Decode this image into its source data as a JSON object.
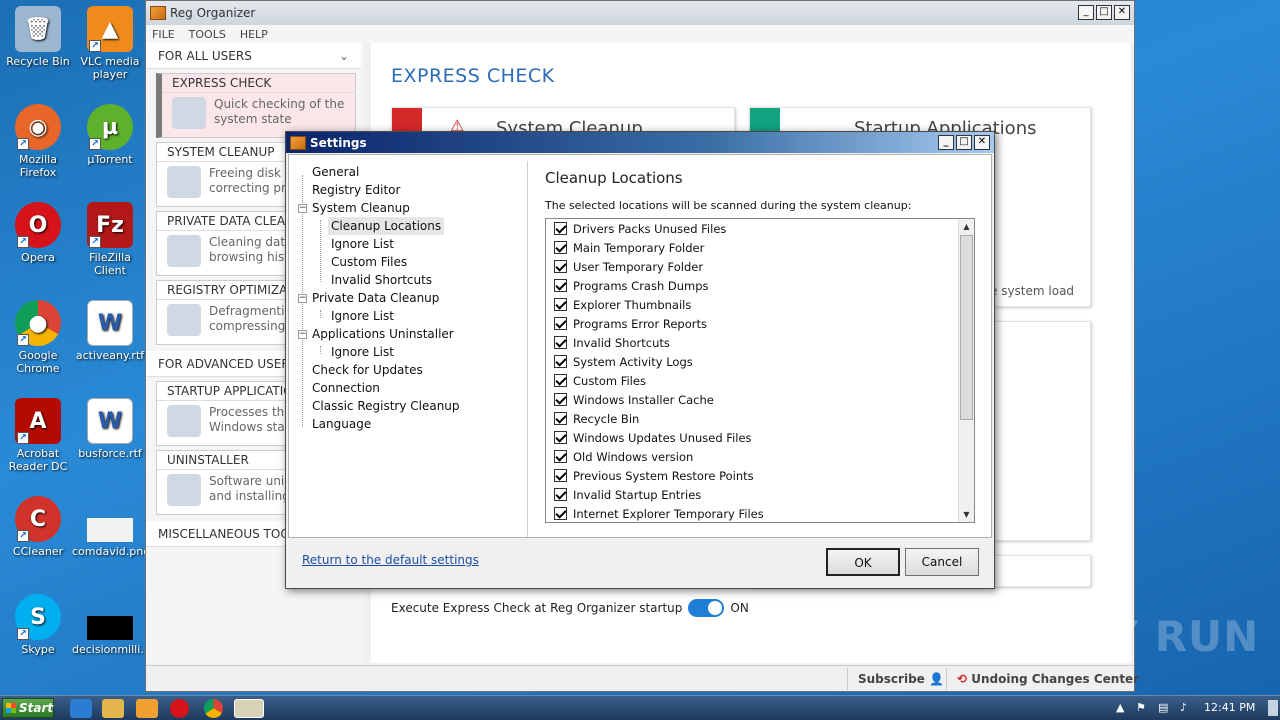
{
  "desktop": {
    "icons": [
      {
        "label": "Recycle Bin",
        "color": "#9cb6d0"
      },
      {
        "label": "VLC media player",
        "color": "#f08a1c"
      },
      {
        "label": "Mozilla Firefox",
        "color": "#e8662a"
      },
      {
        "label": "µTorrent",
        "color": "#5eb12b"
      },
      {
        "label": "Opera",
        "color": "#d6121a"
      },
      {
        "label": "FileZilla Client",
        "color": "#b31818"
      },
      {
        "label": "Google Chrome",
        "color": "#3b8ad9"
      },
      {
        "label": "activeany.rtf",
        "color": "#2a5ba8"
      },
      {
        "label": "Acrobat Reader DC",
        "color": "#b30b00"
      },
      {
        "label": "busforce.rtf",
        "color": "#2a5ba8"
      },
      {
        "label": "CCleaner",
        "color": "#d1332b"
      },
      {
        "label": "comdavid.png",
        "color": "#f2f2f2"
      },
      {
        "label": "Skype",
        "color": "#00aff0"
      },
      {
        "label": "decisionmilli...",
        "color": "#000000"
      }
    ]
  },
  "app": {
    "title": "Reg Organizer",
    "menu": [
      "FILE",
      "TOOLS",
      "HELP"
    ],
    "sidebar": {
      "all_users": "FOR ALL USERS",
      "advanced_users": "FOR ADVANCED USERS",
      "misc": "MISCELLANEOUS TOOLS",
      "items": [
        {
          "title": "EXPRESS CHECK",
          "line1": "Quick checking of the",
          "line2": "system state"
        },
        {
          "title": "SYSTEM CLEANUP",
          "line1": "Freeing disk s",
          "line2": "correcting pro"
        },
        {
          "title": "PRIVATE DATA CLEA",
          "line1": "Cleaning data",
          "line2": "browsing hist"
        },
        {
          "title": "REGISTRY OPTIMIZA",
          "line1": "Defragmentin",
          "line2": "compressing"
        },
        {
          "title": "STARTUP APPLICATIO",
          "line1": "Processes tha",
          "line2": "Windows star"
        },
        {
          "title": "UNINSTALLER",
          "line1": "Software unin",
          "line2": "and installing"
        }
      ]
    },
    "content": {
      "title": "EXPRESS CHECK",
      "card1_title": "System Cleanup",
      "card2_title": "Startup Applications",
      "card2_text": "e system load",
      "startup_label": "Execute Express Check at Reg Organizer startup",
      "toggle_state": "ON"
    },
    "statusbar": {
      "subscribe": "Subscribe",
      "undo_center": "Undoing Changes Center"
    }
  },
  "dialog": {
    "title": "Settings",
    "tree": [
      "General",
      "Registry Editor",
      "System Cleanup",
      "Cleanup Locations",
      "Ignore List",
      "Custom Files",
      "Invalid Shortcuts",
      "Private Data Cleanup",
      "Ignore List",
      "Applications Uninstaller",
      "Ignore List",
      "Check for Updates",
      "Connection",
      "Classic Registry Cleanup",
      "Language"
    ],
    "section_title": "Cleanup Locations",
    "section_desc": "The selected locations will be scanned during the system cleanup:",
    "locations": [
      "Drivers Packs Unused Files",
      "Main Temporary Folder",
      "User Temporary Folder",
      "Programs Crash Dumps",
      "Explorer Thumbnails",
      "Programs Error Reports",
      "Invalid Shortcuts",
      "System Activity Logs",
      "Custom Files",
      "Windows Installer Cache",
      "Recycle Bin",
      "Windows Updates Unused Files",
      "Old Windows version",
      "Previous System Restore Points",
      "Invalid Startup Entries",
      "Internet Explorer Temporary Files"
    ],
    "reset_link": "Return to the default settings",
    "ok": "OK",
    "cancel": "Cancel"
  },
  "taskbar": {
    "start": "Start",
    "clock": "12:41 PM"
  },
  "watermark": "ANY RUN"
}
